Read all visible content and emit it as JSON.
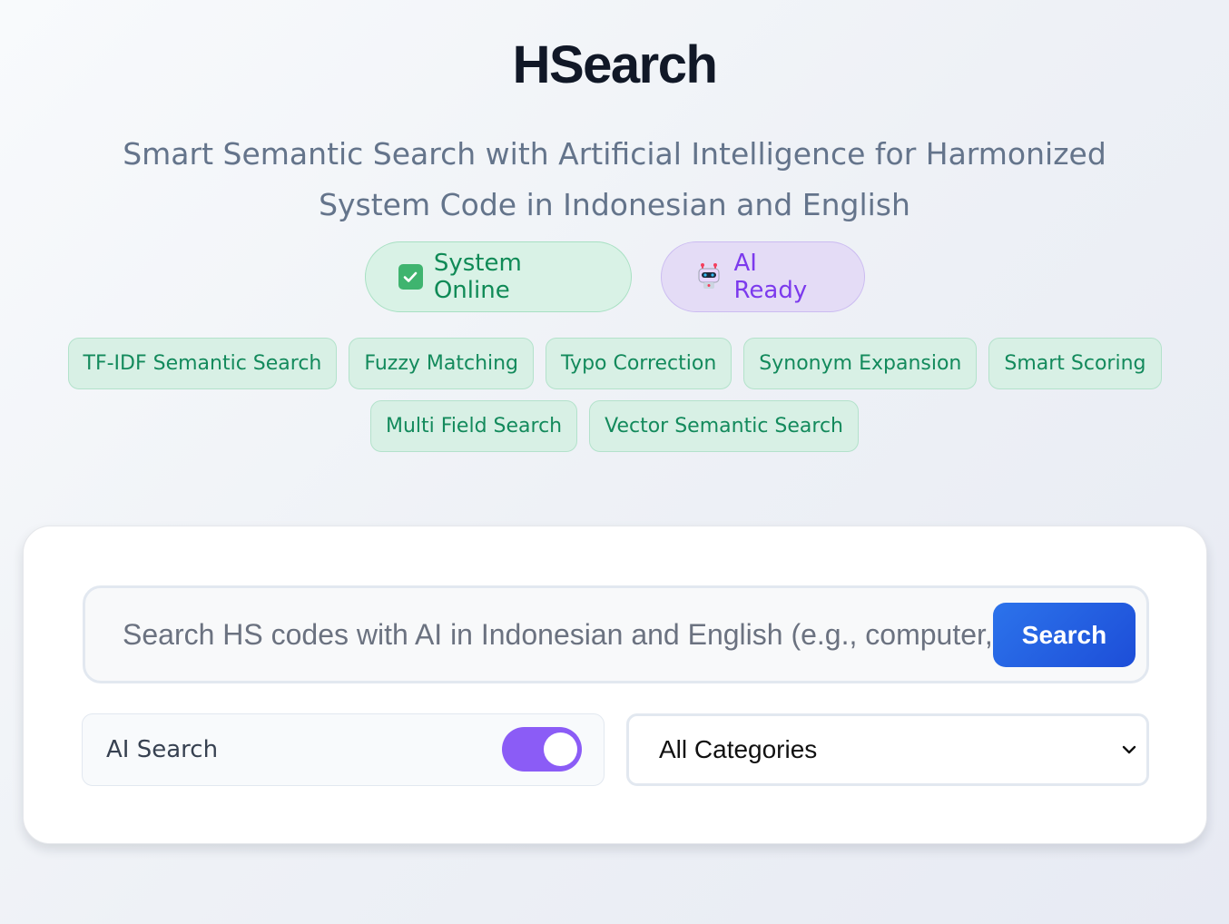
{
  "app": {
    "title": "HSearch",
    "subtitle": "Smart Semantic Search with Artificial Intelligence for Harmonized System Code in Indonesian and English"
  },
  "status": {
    "online": {
      "label": "System Online",
      "icon": "check-icon",
      "color": "#0f8a56"
    },
    "ai": {
      "label": "AI Ready",
      "icon": "robot-icon",
      "color": "#7c3aed"
    }
  },
  "features": [
    "TF-IDF Semantic Search",
    "Fuzzy Matching",
    "Typo Correction",
    "Synonym Expansion",
    "Smart Scoring",
    "Multi Field Search",
    "Vector Semantic Search"
  ],
  "search": {
    "placeholder": "Search HS codes with AI in Indonesian and English (e.g., computer, smartphone)",
    "value": "",
    "button_label": "Search"
  },
  "ai_search": {
    "label": "AI Search",
    "enabled": true
  },
  "category": {
    "selected": "All Categories"
  },
  "colors": {
    "accent_blue": "#1d4ed8",
    "accent_purple": "#8b5cf6",
    "feature_green": "#138a5c"
  }
}
